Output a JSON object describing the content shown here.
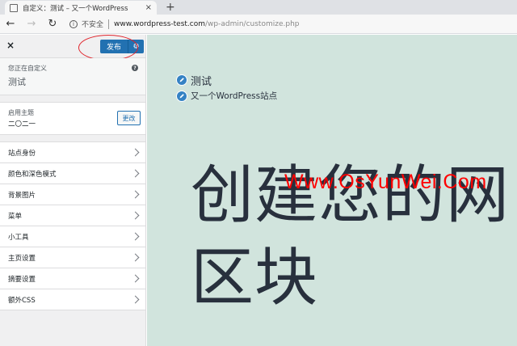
{
  "browser": {
    "tab_title": "自定义：测试 – 又一个WordPress",
    "tab_close": "×",
    "new_tab": "+",
    "back": "←",
    "forward": "→",
    "reload": "↻",
    "info_glyph": "i",
    "insecure_label": "不安全",
    "url_host": "www.wordpress-test.com",
    "url_path": "/wp-admin/customize.php"
  },
  "sidebar": {
    "close": "×",
    "publish_label": "发布",
    "gear": "⚙",
    "info_label": "您正在自定义",
    "site_name": "测试",
    "help": "?",
    "theme_label": "启用主题",
    "theme_name": "二〇二一",
    "change_label": "更改",
    "items": [
      {
        "label": "站点身份"
      },
      {
        "label": "颜色和深色模式"
      },
      {
        "label": "背景图片"
      },
      {
        "label": "菜单"
      },
      {
        "label": "小工具"
      },
      {
        "label": "主页设置"
      },
      {
        "label": "摘要设置"
      },
      {
        "label": "额外CSS"
      }
    ]
  },
  "preview": {
    "site_title": "测试",
    "tagline": "又一个WordPress站点",
    "hero_line1": "创建您的网",
    "hero_line2": "区块"
  },
  "watermark": "Www.OsYunWei.Com",
  "colors": {
    "accent": "#2271b1",
    "preview_bg": "#d1e4dd",
    "annotation": "#e0242b"
  }
}
